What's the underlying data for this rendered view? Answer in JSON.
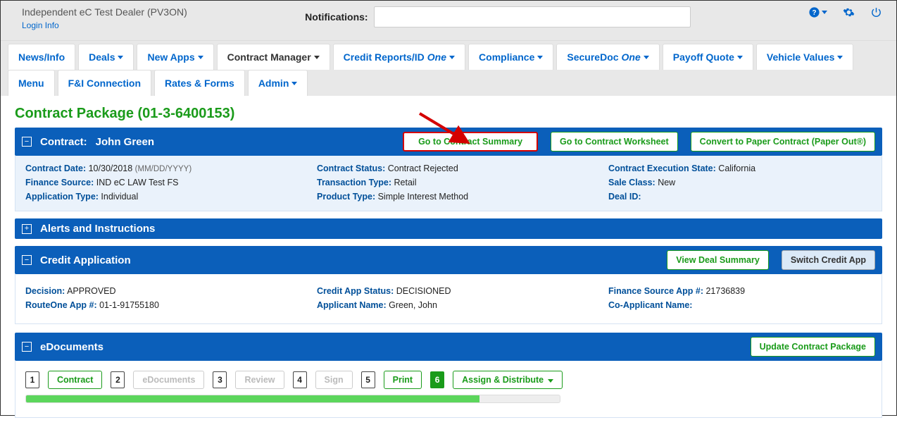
{
  "header": {
    "dealer_name": "Independent eC Test Dealer (PV3ON)",
    "login_info": "Login Info",
    "notifications_label": "Notifications:"
  },
  "nav": {
    "row1": [
      {
        "label": "News/Info",
        "caret": false
      },
      {
        "label": "Deals",
        "caret": true
      },
      {
        "label": "New Apps",
        "caret": true
      },
      {
        "label": "Contract Manager",
        "caret": true,
        "active": true
      },
      {
        "label": "Credit Reports/ID",
        "one": "One",
        "caret": true
      },
      {
        "label": "Compliance",
        "caret": true
      },
      {
        "label": "SecureDoc",
        "one": "One",
        "caret": true
      },
      {
        "label": "Payoff Quote",
        "caret": true
      },
      {
        "label": "Vehicle Values",
        "caret": true
      }
    ],
    "row2": [
      {
        "label": "Menu"
      },
      {
        "label": "F&I Connection"
      },
      {
        "label": "Rates & Forms"
      },
      {
        "label": "Admin",
        "caret": true
      }
    ]
  },
  "page_title": "Contract Package (01-3-6400153)",
  "contract_panel": {
    "title": "Contract:",
    "name": "John Green",
    "btn_summary": "Go to Contract Summary",
    "btn_worksheet": "Go to Contract Worksheet",
    "btn_paper": "Convert to Paper Contract (Paper Out®)",
    "fields": {
      "contract_date_k": "Contract Date:",
      "contract_date_v": "10/30/2018",
      "contract_date_hint": "(MM/DD/YYYY)",
      "finance_source_k": "Finance Source:",
      "finance_source_v": "IND eC LAW Test FS",
      "app_type_k": "Application Type:",
      "app_type_v": "Individual",
      "contract_status_k": "Contract Status:",
      "contract_status_v": "Contract Rejected",
      "txn_type_k": "Transaction Type:",
      "txn_type_v": "Retail",
      "product_type_k": "Product Type:",
      "product_type_v": "Simple Interest Method",
      "exec_state_k": "Contract Execution State:",
      "exec_state_v": "California",
      "sale_class_k": "Sale Class:",
      "sale_class_v": "New",
      "deal_id_k": "Deal ID:",
      "deal_id_v": ""
    }
  },
  "alerts_panel": {
    "title": "Alerts and Instructions"
  },
  "credit_panel": {
    "title": "Credit Application",
    "btn_view": "View Deal Summary",
    "btn_switch": "Switch Credit App",
    "fields": {
      "decision_k": "Decision:",
      "decision_v": "APPROVED",
      "routeone_k": "RouteOne App #:",
      "routeone_v": "01-1-91755180",
      "appstatus_k": "Credit App Status:",
      "appstatus_v": "DECISIONED",
      "applicant_k": "Applicant Name:",
      "applicant_v": "Green, John",
      "fsapp_k": "Finance Source App #:",
      "fsapp_v": "21736839",
      "coapp_k": "Co-Applicant Name:",
      "coapp_v": ""
    }
  },
  "edoc_panel": {
    "title": "eDocuments",
    "btn_update": "Update Contract Package",
    "steps": [
      {
        "num": "1",
        "label": "Contract",
        "state": "normal"
      },
      {
        "num": "2",
        "label": "eDocuments",
        "state": "disabled"
      },
      {
        "num": "3",
        "label": "Review",
        "state": "disabled"
      },
      {
        "num": "4",
        "label": "Sign",
        "state": "disabled"
      },
      {
        "num": "5",
        "label": "Print",
        "state": "normal"
      },
      {
        "num": "6",
        "label": "Assign & Distribute",
        "state": "active",
        "caret": true
      }
    ]
  }
}
